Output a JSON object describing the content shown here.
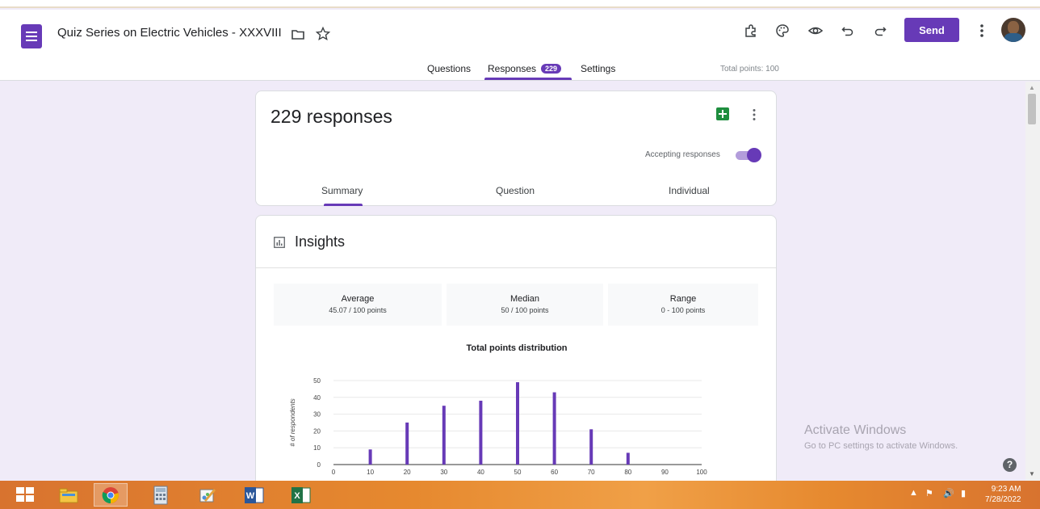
{
  "header": {
    "title": "Quiz Series on Electric Vehicles - XXXVIII",
    "send_label": "Send",
    "icons": [
      "forms-logo-icon",
      "folder-icon",
      "star-icon",
      "addon-icon",
      "palette-icon",
      "preview-eye-icon",
      "undo-icon",
      "redo-icon",
      "more-vert-icon",
      "avatar"
    ],
    "accent_color": "#673ab7"
  },
  "tabs": {
    "questions": "Questions",
    "responses": "Responses",
    "responses_badge": "229",
    "settings": "Settings",
    "active": "Responses",
    "total_points": "Total points: 100"
  },
  "responses_card": {
    "count_label": "229 responses",
    "accepting_label": "Accepting responses",
    "accepting": true,
    "subtabs": [
      "Summary",
      "Question",
      "Individual"
    ],
    "active_subtab": "Summary"
  },
  "insights": {
    "title": "Insights",
    "stats": [
      {
        "label": "Average",
        "value": "45.07 / 100 points"
      },
      {
        "label": "Median",
        "value": "50 / 100 points"
      },
      {
        "label": "Range",
        "value": "0 - 100 points"
      }
    ]
  },
  "chart_data": {
    "type": "bar",
    "title": "Total points distribution",
    "ylabel": "# of respondents",
    "xlabel": "",
    "x_ticks": [
      "0",
      "10",
      "20",
      "30",
      "40",
      "50",
      "60",
      "70",
      "80",
      "90",
      "100"
    ],
    "y_ticks": [
      "0",
      "10",
      "20",
      "30",
      "40",
      "50"
    ],
    "x": [
      0,
      10,
      20,
      30,
      40,
      50,
      60,
      70,
      80,
      90,
      100
    ],
    "values": [
      0,
      9,
      25,
      35,
      38,
      49,
      43,
      21,
      7,
      0,
      0
    ],
    "xlim": [
      0,
      100
    ],
    "ylim": [
      0,
      50
    ],
    "grid": true,
    "bar_color": "#673ab7"
  },
  "watermark": {
    "line1": "Activate Windows",
    "line2": "Go to PC settings to activate Windows."
  },
  "taskbar": {
    "items": [
      "windows-start-icon",
      "file-explorer-icon",
      "chrome-icon",
      "calculator-icon",
      "paint-icon",
      "word-icon",
      "excel-icon"
    ],
    "clock_time": "9:23 AM",
    "clock_date": "7/28/2022"
  }
}
